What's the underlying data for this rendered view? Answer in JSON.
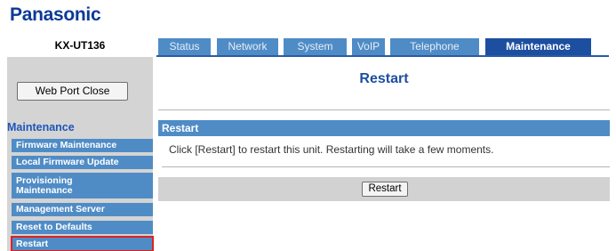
{
  "brand": {
    "logo_text": "Panasonic"
  },
  "header": {
    "model": "KX-UT136",
    "tabs": [
      {
        "label": "Status"
      },
      {
        "label": "Network"
      },
      {
        "label": "System"
      },
      {
        "label": "VoIP"
      },
      {
        "label": "Telephone"
      },
      {
        "label": "Maintenance",
        "active": true
      }
    ]
  },
  "sidebar": {
    "web_port_close_label": "Web Port Close",
    "heading": "Maintenance",
    "items": [
      {
        "label": "Firmware Maintenance"
      },
      {
        "label": "Local Firmware Update"
      },
      {
        "label": "Provisioning Maintenance"
      },
      {
        "label": "Management Server"
      },
      {
        "label": "Reset to Defaults"
      },
      {
        "label": "Restart",
        "selected": true
      }
    ]
  },
  "main": {
    "page_title": "Restart",
    "section_title": "Restart",
    "description": "Click [Restart] to restart this unit. Restarting will take a few moments.",
    "restart_button_label": "Restart"
  },
  "colors": {
    "brand_blue": "#0c3a96",
    "tab_blue": "#4f8cc6",
    "tab_active": "#1c4fa0",
    "selection_outline": "#e0201f",
    "panel_gray": "#d4d4d4"
  }
}
